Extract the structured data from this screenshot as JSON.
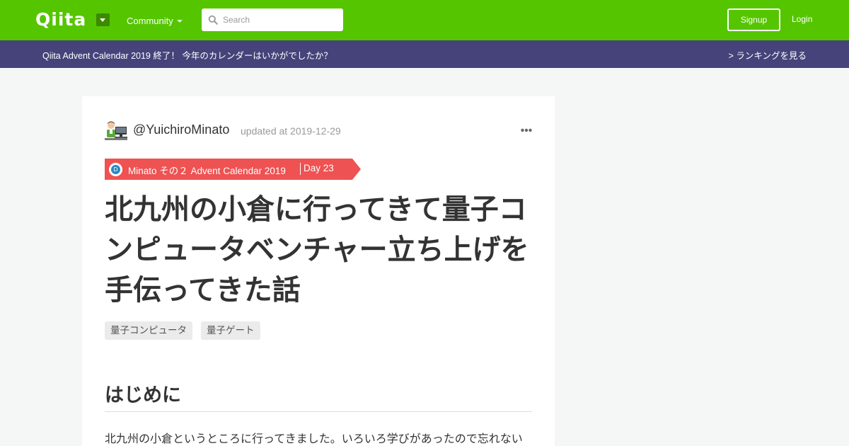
{
  "header": {
    "logo": "Qiita",
    "community_label": "Community",
    "search_placeholder": "Search",
    "signup_label": "Signup",
    "login_label": "Login",
    "brand_color": "#55c500"
  },
  "banner": {
    "text": "Qiita Advent Calendar 2019 終了！ 今年のカレンダーはいかがでしたか？",
    "link": "> ランキングを見る",
    "color": "#45437a"
  },
  "article": {
    "author": "@YuichiroMinato",
    "updated": "updated at 2019-12-29",
    "calendar": {
      "icon_letter": "D",
      "name": "Minato その２ Advent Calendar 2019",
      "day": "Day 23",
      "color": "#ee5252"
    },
    "title": "北九州の小倉に行ってきて量子コンピュータベンチャー立ち上げを手伝ってきた話",
    "tags": [
      "量子コンピュータ",
      "量子ゲート"
    ],
    "section_heading": "はじめに",
    "paragraph": "北九州の小倉というところに行ってきました。いろいろ学びがあったので忘れない"
  }
}
